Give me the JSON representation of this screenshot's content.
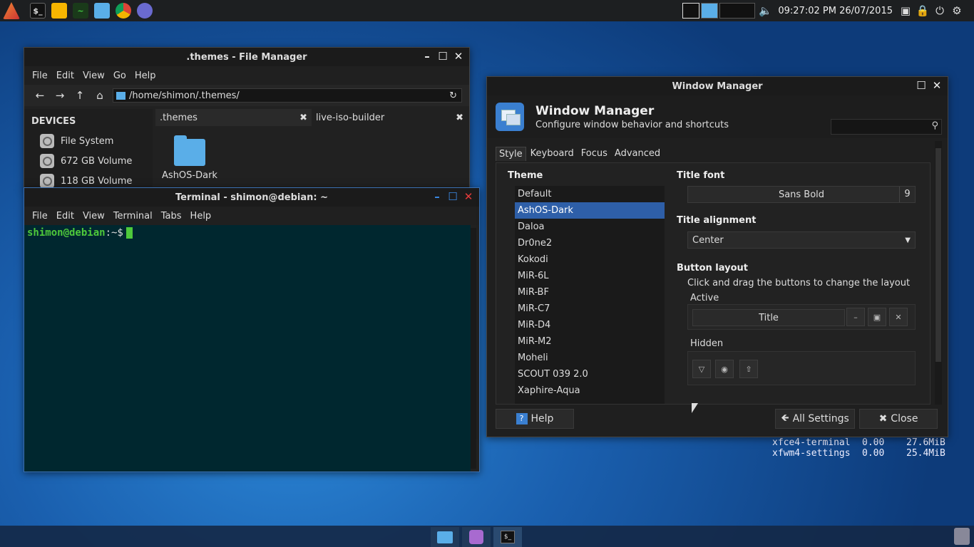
{
  "top_panel": {
    "clock": "09:27:02 PM 26/07/2015",
    "launchers": [
      "app-menu-icon",
      "terminal-icon",
      "fruit-icon",
      "system-monitor-icon",
      "files-icon",
      "chrome-icon",
      "pidgin-icon"
    ]
  },
  "file_manager": {
    "title": ".themes - File Manager",
    "menu": [
      "File",
      "Edit",
      "View",
      "Go",
      "Help"
    ],
    "path": "/home/shimon/.themes/",
    "devices_heading": "DEVICES",
    "devices": [
      "File System",
      "672 GB Volume",
      "118 GB Volume"
    ],
    "tabs": [
      ".themes",
      "live-iso-builder"
    ],
    "folder_name": "AshOS-Dark"
  },
  "terminal": {
    "title": "Terminal - shimon@debian: ~",
    "menu": [
      "File",
      "Edit",
      "View",
      "Terminal",
      "Tabs",
      "Help"
    ],
    "prompt_user": "shimon@debian",
    "prompt_path": ":~$"
  },
  "window_manager": {
    "window_title": "Window Manager",
    "header_title": "Window Manager",
    "header_subtitle": "Configure window behavior and shortcuts",
    "tabs": [
      "Style",
      "Keyboard",
      "Focus",
      "Advanced"
    ],
    "theme_label": "Theme",
    "themes": [
      "Default",
      "AshOS-Dark",
      "Daloa",
      "Dr0ne2",
      "Kokodi",
      "MiR-6L",
      "MiR-BF",
      "MiR-C7",
      "MiR-D4",
      "MiR-M2",
      "Moheli",
      "SCOUT 039 2.0",
      "Xaphire-Aqua"
    ],
    "selected_theme": "AshOS-Dark",
    "title_font_label": "Title font",
    "title_font": "Sans Bold",
    "title_font_size": "9",
    "title_alignment_label": "Title alignment",
    "title_alignment": "Center",
    "button_layout_label": "Button layout",
    "button_layout_hint": "Click and drag the buttons to change the layout",
    "active_label": "Active",
    "active_title": "Title",
    "hidden_label": "Hidden",
    "help_label": "Help",
    "all_settings_label": "All Settings",
    "close_label": "Close"
  },
  "conky": {
    "processes": [
      {
        "name": "xfce4-terminal",
        "cpu": "0.00",
        "mem": "27.6MiB"
      },
      {
        "name": "xfwm4-settings",
        "cpu": "0.00",
        "mem": "25.4MiB"
      }
    ]
  }
}
